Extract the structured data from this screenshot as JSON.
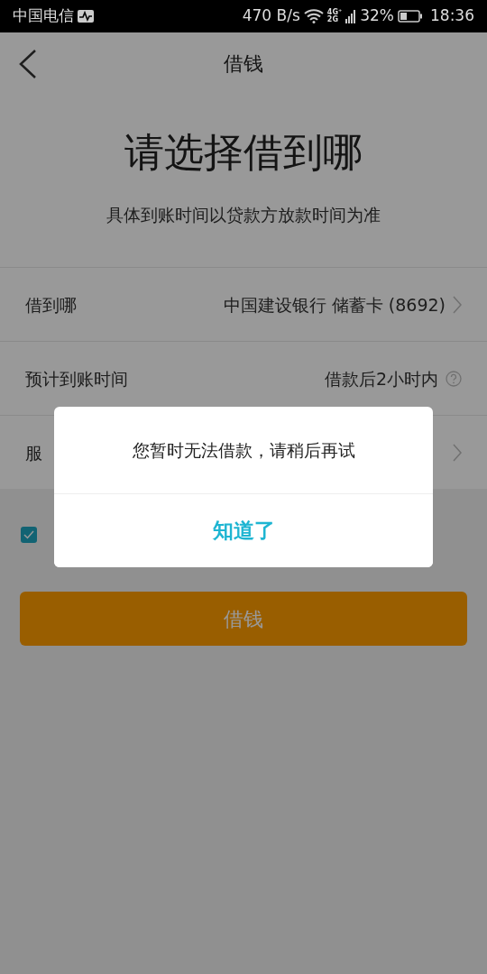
{
  "status_bar": {
    "carrier": "中国电信",
    "speed": "470 B/s",
    "network": "4G⁺",
    "network_2": "2G",
    "battery": "32%",
    "time": "18:36"
  },
  "nav": {
    "title": "借钱"
  },
  "heading": "请选择借到哪",
  "subheading": "具体到账时间以贷款方放款时间为准",
  "rows": [
    {
      "label": "借到哪",
      "value": "中国建设银行 储蓄卡 (8692)",
      "kind": "chevron"
    },
    {
      "label": "预计到账时间",
      "value": "借款后2小时内",
      "kind": "help"
    },
    {
      "label": "服",
      "kind": "chevron"
    }
  ],
  "agreement": {
    "checked": true
  },
  "submit_button": "借钱",
  "dialog": {
    "message": "您暂时无法借款，请稍后再试",
    "button": "知道了"
  }
}
